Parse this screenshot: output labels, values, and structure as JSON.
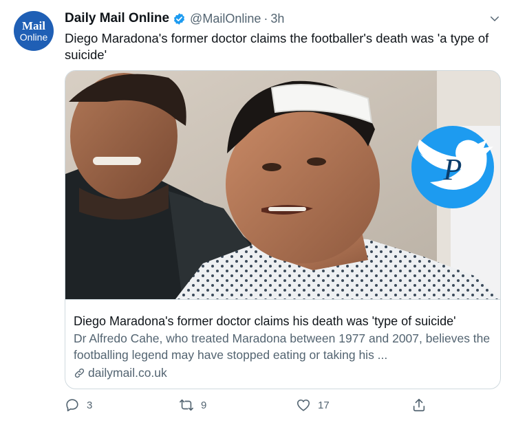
{
  "account": {
    "avatar_line1": "Mail",
    "avatar_line2": "Online",
    "name": "Daily Mail Online",
    "handle": "@MailOnline",
    "separator": "·",
    "time": "3h"
  },
  "tweet": {
    "text": "Diego Maradona's former doctor claims the footballer's death was 'a type of suicide'"
  },
  "card": {
    "title": "Diego Maradona's former doctor claims his death was 'type of suicide'",
    "description": "Dr Alfredo Cahe, who treated Maradona between 1977 and 2007, believes the footballing legend may have stopped eating or taking his ...",
    "domain": "dailymail.co.uk",
    "watermark_letter": "P"
  },
  "actions": {
    "reply_count": "3",
    "retweet_count": "9",
    "like_count": "17"
  },
  "colors": {
    "brand_blue": "#1d9bf0",
    "avatar_bg": "#1f5fb5",
    "secondary_text": "#536471",
    "border": "#cfd9de"
  }
}
